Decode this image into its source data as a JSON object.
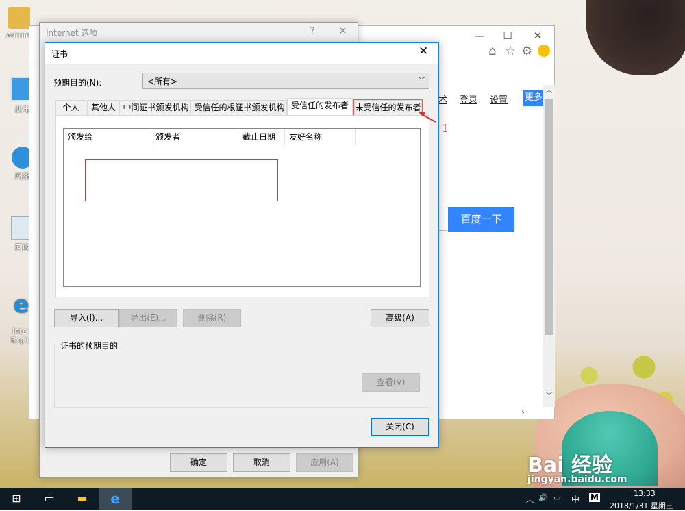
{
  "desktop": {
    "icons": [
      {
        "label": "Admini"
      },
      {
        "label": "此电"
      },
      {
        "label": "网络"
      },
      {
        "label": "回收"
      },
      {
        "label": "Inter\nExplo"
      }
    ]
  },
  "browser": {
    "links": [
      "术",
      "登录",
      "设置"
    ],
    "more_label": "更多",
    "search_button": "百度一下"
  },
  "internet_options": {
    "title": "Internet 选项",
    "help": "?",
    "close": "✕",
    "buttons": {
      "ok": "确定",
      "cancel": "取消",
      "apply": "应用(A)"
    }
  },
  "certificate_dialog": {
    "title": "证书",
    "close": "✕",
    "purpose_label": "预期目的(N):",
    "purpose_value": "<所有>",
    "tabs": [
      "个人",
      "其他人",
      "中间证书颁发机构",
      "受信任的根证书颁发机构",
      "受信任的发布者",
      "未受信任的发布者"
    ],
    "active_tab": "受信任的发布者",
    "columns": [
      "颁发给",
      "颁发者",
      "截止日期",
      "友好名称"
    ],
    "buttons": {
      "import": "导入(I)...",
      "export": "导出(E)...",
      "remove": "删除(R)",
      "advanced": "高级(A)",
      "view": "查看(V)",
      "close": "关闭(C)"
    },
    "purposes_group_label": "证书的预期目的"
  },
  "annotation": {
    "number": "1",
    "color": "#d33333"
  },
  "taskbar": {
    "time": "13:33",
    "date": "2018/1/31 星期三",
    "ime": "中",
    "ime_mode": "M"
  },
  "watermark": {
    "logo": "Bai 经验",
    "url": "jingyan.baidu.com"
  }
}
